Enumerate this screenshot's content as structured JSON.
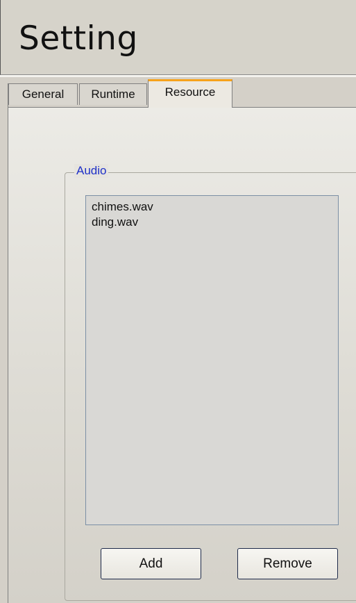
{
  "header": {
    "title": "Setting"
  },
  "tabs": [
    {
      "label": "General",
      "selected": false
    },
    {
      "label": "Runtime",
      "selected": false
    },
    {
      "label": "Resource",
      "selected": true
    }
  ],
  "audio_group": {
    "label": "Audio",
    "files": [
      "chimes.wav",
      "ding.wav"
    ],
    "add_label": "Add",
    "remove_label": "Remove"
  },
  "colors": {
    "background": "#d4d0c8",
    "active_tab_accent": "#f7a21b",
    "group_label": "#1e30c8"
  }
}
